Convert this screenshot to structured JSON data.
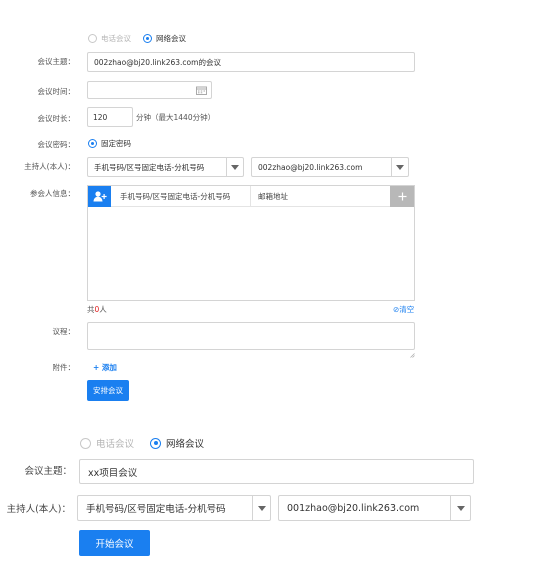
{
  "colors": {
    "accent": "#1a7ff0",
    "count_red": "#e02020",
    "border": "#d4d4d4",
    "add_gray": "#b8b8b8"
  },
  "top": {
    "meeting_type": {
      "phone_label": "电话会议",
      "network_label": "网络会议",
      "selected": "网络会议"
    },
    "subject": {
      "label": "会议主题：",
      "value": "002zhao@bj20.link263.com的会议"
    },
    "time": {
      "label": "会议时间：",
      "value": "",
      "icon": "calendar-icon"
    },
    "duration": {
      "label": "会议时长：",
      "value": "120",
      "unit": "分钟（最大1440分钟）"
    },
    "password": {
      "label": "会议密码：",
      "option": "固定密码"
    },
    "host": {
      "label": "主持人(本人)：",
      "phone_value": "手机号码/区号固定电话-分机号码",
      "email_value": "002zhao@bj20.link263.com"
    },
    "participants": {
      "label": "参会人信息：",
      "phone_header": "手机号码/区号固定电话-分机号码",
      "email_header": "邮箱地址",
      "add_user_icon": "add-user-icon",
      "add_icon": "plus-icon",
      "count_prefix": "共",
      "count": "0",
      "count_suffix": "人",
      "clear_label": "清空"
    },
    "agenda": {
      "label": "议程：",
      "value": ""
    },
    "attachment": {
      "label": "附件：",
      "add_label": "+ 添加"
    },
    "submit_label": "安排会议"
  },
  "bottom": {
    "meeting_type": {
      "phone_label": "电话会议",
      "network_label": "网络会议",
      "selected": "网络会议"
    },
    "subject": {
      "label": "会议主题：",
      "value": "xx项目会议"
    },
    "host": {
      "label": "主持人(本人)：",
      "phone_value": "手机号码/区号固定电话-分机号码",
      "email_value": "001zhao@bj20.link263.com"
    },
    "submit_label": "开始会议"
  }
}
